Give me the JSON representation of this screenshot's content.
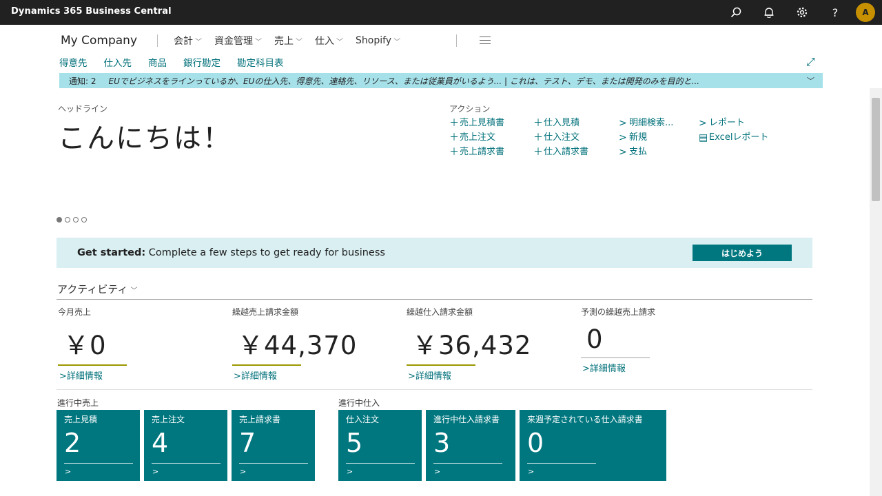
{
  "app": {
    "title": "Dynamics 365 Business Central",
    "user_initial": "A"
  },
  "nav": {
    "company": "My Company",
    "items": [
      {
        "label": "会計"
      },
      {
        "label": "資金管理"
      },
      {
        "label": "売上"
      },
      {
        "label": "仕入"
      },
      {
        "label": "Shopify"
      }
    ],
    "quicklinks": [
      "得意先",
      "仕入先",
      "商品",
      "銀行勘定",
      "勘定科目表"
    ]
  },
  "notification": {
    "label": "通知: 2",
    "message": "EUでビジネスをラインっているか、EUの仕入先、得意先、連絡先、リソース、または従業員がいるよう...  |  これは、テスト、デモ、または開発のみを目的と..."
  },
  "headline": {
    "label": "ヘッドライン",
    "greeting": "こんにちは！"
  },
  "actions": {
    "label": "アクション",
    "col1": [
      "売上見積書",
      "売上注文",
      "売上請求書"
    ],
    "col2": [
      "仕入見積",
      "仕入注文",
      "仕入請求書"
    ],
    "col3": [
      "明細検索...",
      "新規",
      "支払"
    ],
    "col4": [
      "レポート",
      "Excelレポート"
    ]
  },
  "get_started": {
    "lead": "Get started:",
    "text": " Complete a few steps to get ready for business",
    "button": "はじめよう"
  },
  "activities": {
    "title": "アクティビティ",
    "cues": [
      {
        "label": "今月売上",
        "value": "￥0",
        "link": "詳細情報"
      },
      {
        "label": "繰越売上請求金額",
        "value": "￥44,370",
        "link": "詳細情報"
      },
      {
        "label": "繰越仕入請求金額",
        "value": "￥36,432",
        "link": "詳細情報"
      },
      {
        "label": "予測の繰越売上請求",
        "value": "0",
        "link": "詳細情報"
      }
    ]
  },
  "sales_ongoing": {
    "label": "進行中売上",
    "tiles": [
      {
        "label": "売上見積",
        "value": "2"
      },
      {
        "label": "売上注文",
        "value": "4"
      },
      {
        "label": "売上請求書",
        "value": "7"
      }
    ]
  },
  "purchase_ongoing": {
    "label": "進行中仕入",
    "tiles": [
      {
        "label": "仕入注文",
        "value": "5"
      },
      {
        "label": "進行中仕入請求書",
        "value": "3"
      },
      {
        "label": "来週予定されている仕入請求書",
        "value": "0"
      }
    ]
  }
}
